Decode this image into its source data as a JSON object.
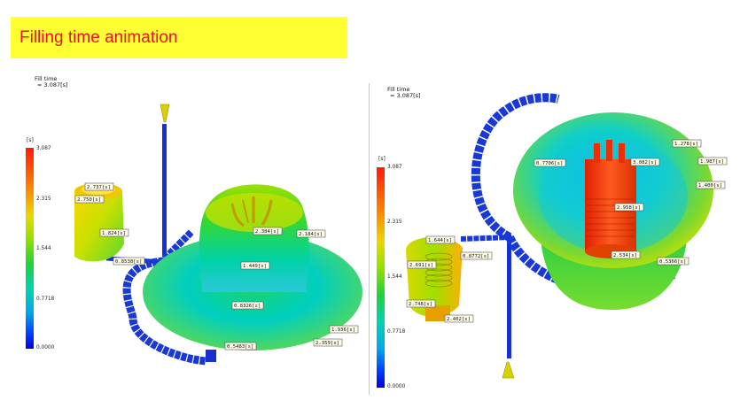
{
  "title": "Filling time animation",
  "left_view": {
    "fill_time": "Fill time",
    "fill_value": "= 3.087[s]",
    "unit": "[s]",
    "scale": [
      "3.087",
      "2.315",
      "1.544",
      "0.7718",
      "0.0000"
    ],
    "labels": [
      "2.737[s]",
      "2.750[s]",
      "1.824[s]",
      "0.8538[s]",
      "2.384[s]",
      "2.184[s]",
      "1.449[s]",
      "0.8326[s]",
      "1.936[s]",
      "2.359[s]",
      "0.5483[s]"
    ]
  },
  "right_view": {
    "fill_time": "Fill time",
    "fill_value": "= 3.087[s]",
    "unit": "[s]",
    "scale": [
      "3.087",
      "2.315",
      "1.544",
      "0.7718",
      "0.0000"
    ],
    "labels": [
      "1.644[s]",
      "0.8772[s]",
      "2.691[s]",
      "2.748[s]",
      "2.402[s]",
      "0.7706[s]",
      "3.082[s]",
      "2.958[s]",
      "1.278[s]",
      "1.987[s]",
      "1.400[s]",
      "2.534[s]",
      "0.5366[s]"
    ]
  }
}
